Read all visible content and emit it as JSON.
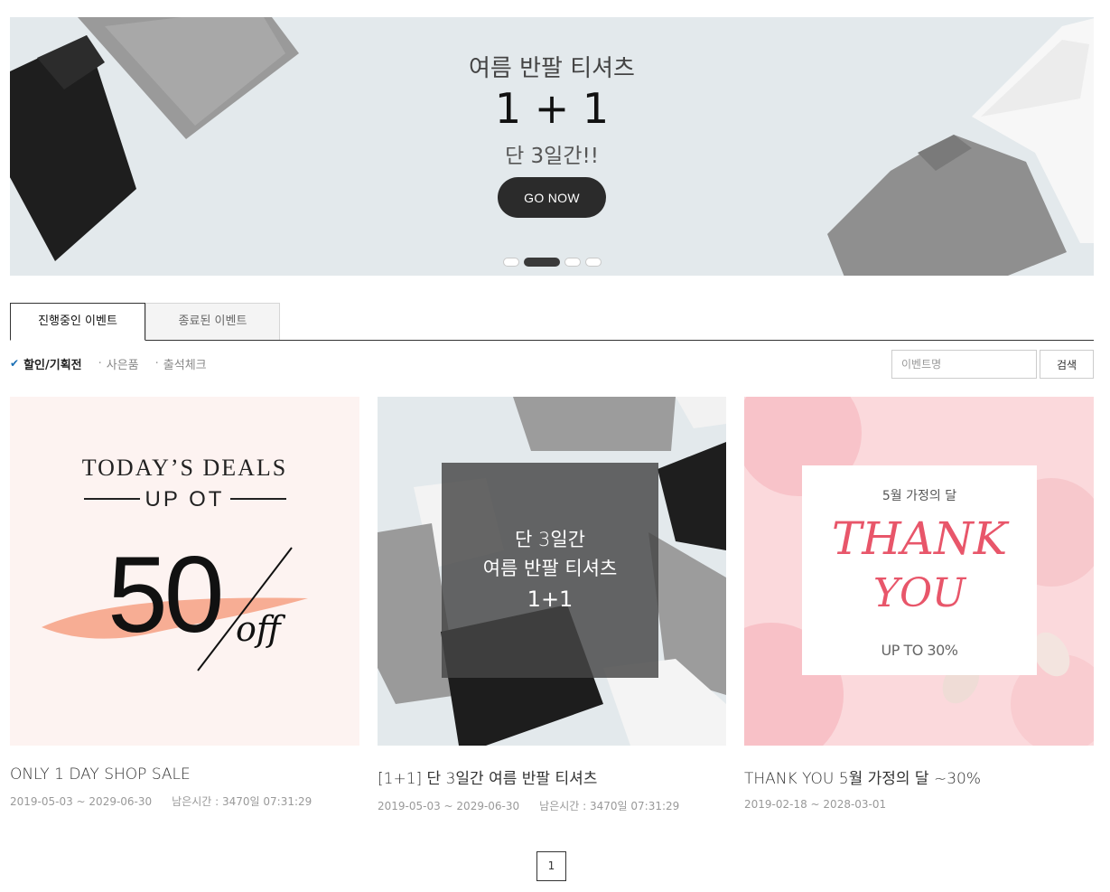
{
  "banner": {
    "subtitle": "여름 반팔 티셔츠",
    "headline": "1 + 1",
    "tagline": "단 3일간!!",
    "button_label": "GO NOW",
    "slide_count": 4,
    "active_slide": 2
  },
  "tabs": [
    {
      "label": "진행중인 이벤트",
      "active": true
    },
    {
      "label": "종료된 이벤트",
      "active": false
    }
  ],
  "filters": [
    {
      "label": "할인/기획전",
      "active": true
    },
    {
      "label": "사은품",
      "active": false
    },
    {
      "label": "출석체크",
      "active": false
    }
  ],
  "search": {
    "placeholder": "이벤트명",
    "button_label": "검색"
  },
  "events": [
    {
      "title": "ONLY 1 DAY SHOP SALE",
      "period": "2019-05-03 ~ 2029-06-30",
      "remaining": "남은시간 : 3470일 07:31:29",
      "image": {
        "line1": "TODAY’S DEALS",
        "line2": "UP OT",
        "big": "50",
        "script": "off"
      }
    },
    {
      "title": "[1+1] 단 3일간 여름 반팔 티셔츠",
      "period": "2019-05-03 ~ 2029-06-30",
      "remaining": "남은시간 : 3470일 07:31:29",
      "image": {
        "line1": "단 3일간",
        "line2": "여름 반팔 티셔츠",
        "line3": "1+1"
      }
    },
    {
      "title": "THANK YOU 5월 가정의 달 ~30%",
      "period": "2019-02-18 ~ 2028-03-01",
      "remaining": "",
      "image": {
        "line1": "5월 가정의 달",
        "line2": "THANK",
        "line3": "YOU",
        "line4": "UP TO 30%"
      }
    }
  ],
  "pagination": {
    "current": "1"
  },
  "colors": {
    "banner_bg": "#e3e9ec",
    "button_dark": "#2b2b2b",
    "accent_check": "#1a6fb5",
    "peach": "#f6a58a",
    "pink": "#e8566a"
  }
}
